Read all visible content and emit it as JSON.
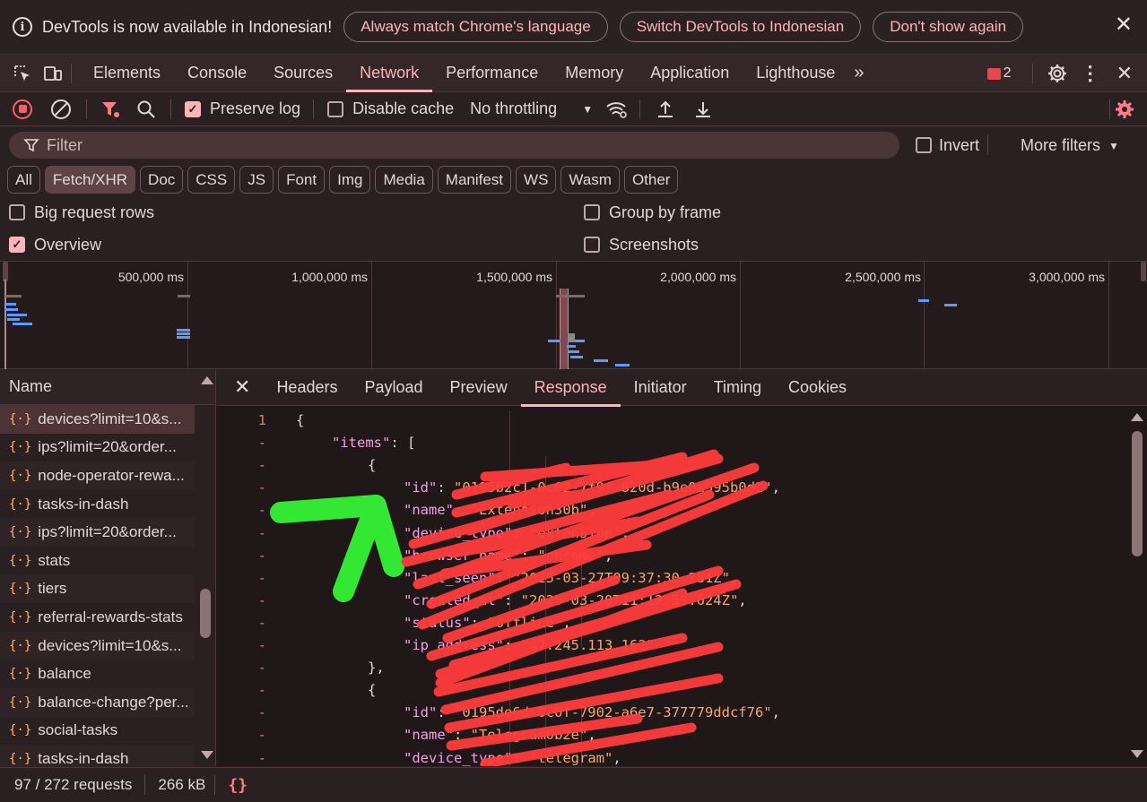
{
  "infobar": {
    "message": "DevTools is now available in Indonesian!",
    "btn_match": "Always match Chrome's language",
    "btn_switch": "Switch DevTools to Indonesian",
    "btn_dont_show": "Don't show again"
  },
  "tabs": [
    "Elements",
    "Console",
    "Sources",
    "Network",
    "Performance",
    "Memory",
    "Application",
    "Lighthouse"
  ],
  "active_tab": "Network",
  "error_count": "2",
  "toolbar": {
    "preserve_log": "Preserve log",
    "preserve_log_checked": true,
    "disable_cache": "Disable cache",
    "throttling": "No throttling"
  },
  "filter": {
    "placeholder": "Filter",
    "invert": "Invert",
    "more_filters": "More filters"
  },
  "type_chips": [
    "All",
    "Fetch/XHR",
    "Doc",
    "CSS",
    "JS",
    "Font",
    "Img",
    "Media",
    "Manifest",
    "WS",
    "Wasm",
    "Other"
  ],
  "active_chip": "Fetch/XHR",
  "options": {
    "big_request_rows": "Big request rows",
    "group_by_frame": "Group by frame",
    "overview": "Overview",
    "screenshots": "Screenshots"
  },
  "overview_ticks": [
    "500,000 ms",
    "1,000,000 ms",
    "1,500,000 ms",
    "2,000,000 ms",
    "2,500,000 ms",
    "3,000,000 ms"
  ],
  "request_list": {
    "header": "Name",
    "items": [
      "devices?limit=10&s...",
      "ips?limit=20&order...",
      "node-operator-rewa...",
      "tasks-in-dash",
      "ips?limit=20&order...",
      "stats",
      "tiers",
      "referral-rewards-stats",
      "devices?limit=10&s...",
      "balance",
      "balance-change?per...",
      "social-tasks",
      "tasks-in-dash"
    ]
  },
  "detail_tabs": [
    "Headers",
    "Payload",
    "Preview",
    "Response",
    "Initiator",
    "Timing",
    "Cookies"
  ],
  "active_detail_tab": "Response",
  "response_lines": [
    {
      "n": "1",
      "indent": 0,
      "parts": [
        [
          "p",
          "{"
        ]
      ]
    },
    {
      "n": "-",
      "indent": 1,
      "parts": [
        [
          "k",
          "\"items\""
        ],
        [
          "p",
          ": ["
        ]
      ]
    },
    {
      "n": "-",
      "indent": 2,
      "parts": [
        [
          "p",
          "{"
        ]
      ]
    },
    {
      "n": "-",
      "indent": 3,
      "parts": [
        [
          "k",
          "\"id\""
        ],
        [
          "p",
          ": "
        ],
        [
          "s",
          "\"0195b2c1-0c02-7f9f-820d-b9e0a595b0d2\""
        ],
        [
          "p",
          ","
        ]
      ]
    },
    {
      "n": "-",
      "indent": 3,
      "parts": [
        [
          "k",
          "\"name\""
        ],
        [
          "p",
          ": "
        ],
        [
          "s",
          "\"Extension30b\""
        ],
        [
          "p",
          ","
        ]
      ]
    },
    {
      "n": "-",
      "indent": 3,
      "parts": [
        [
          "k",
          "\"device_type\""
        ],
        [
          "p",
          ": "
        ],
        [
          "s",
          "\"extension\""
        ],
        [
          "p",
          ","
        ]
      ]
    },
    {
      "n": "-",
      "indent": 3,
      "parts": [
        [
          "k",
          "\"browser_name\""
        ],
        [
          "p",
          ": "
        ],
        [
          "s",
          "\"chrome\""
        ],
        [
          "p",
          ","
        ]
      ]
    },
    {
      "n": "-",
      "indent": 3,
      "parts": [
        [
          "k",
          "\"last_seen\""
        ],
        [
          "p",
          ": "
        ],
        [
          "s",
          "\"2025-03-27T09:37:30.281Z\""
        ],
        [
          "p",
          ","
        ]
      ]
    },
    {
      "n": "-",
      "indent": 3,
      "parts": [
        [
          "k",
          "\"created_at\""
        ],
        [
          "p",
          ": "
        ],
        [
          "s",
          "\"2025-03-20T11:12:53.624Z\""
        ],
        [
          "p",
          ","
        ]
      ]
    },
    {
      "n": "-",
      "indent": 3,
      "parts": [
        [
          "k",
          "\"status\""
        ],
        [
          "p",
          ": "
        ],
        [
          "s",
          "\"offline\""
        ],
        [
          "p",
          ","
        ]
      ]
    },
    {
      "n": "-",
      "indent": 3,
      "parts": [
        [
          "k",
          "\"ip_address\""
        ],
        [
          "p",
          ": "
        ],
        [
          "s",
          "\"47.245.113.162\""
        ]
      ]
    },
    {
      "n": "-",
      "indent": 2,
      "parts": [
        [
          "p",
          "},"
        ]
      ]
    },
    {
      "n": "-",
      "indent": 2,
      "parts": [
        [
          "p",
          "{"
        ]
      ]
    },
    {
      "n": "-",
      "indent": 3,
      "parts": [
        [
          "k",
          "\"id\""
        ],
        [
          "p",
          ": "
        ],
        [
          "s",
          "\"0195de6d-0c0f-7902-a6e7-377779ddcf76\""
        ],
        [
          "p",
          ","
        ]
      ]
    },
    {
      "n": "-",
      "indent": 3,
      "parts": [
        [
          "k",
          "\"name\""
        ],
        [
          "p",
          ": "
        ],
        [
          "s",
          "\"Telegram0b2e\""
        ],
        [
          "p",
          ","
        ]
      ]
    },
    {
      "n": "-",
      "indent": 3,
      "parts": [
        [
          "k",
          "\"device_type\""
        ],
        [
          "p",
          ": "
        ],
        [
          "s",
          "\"telegram\""
        ],
        [
          "p",
          ","
        ]
      ]
    }
  ],
  "status": {
    "requests": "97 / 272 requests",
    "transferred": "266 kB"
  },
  "colors": {
    "accent": "#ffb3bb",
    "annotation_arrow": "#33e833",
    "scribble": "#ff3b3b"
  }
}
